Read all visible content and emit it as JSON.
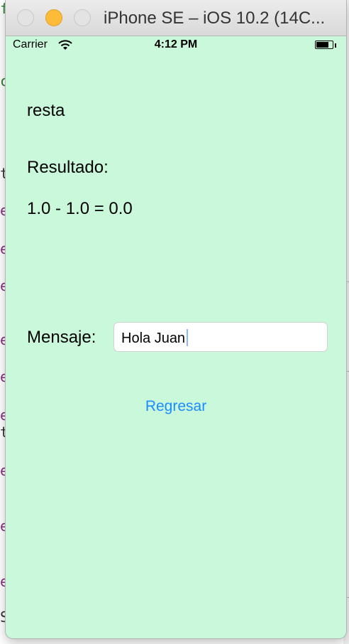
{
  "window": {
    "title": "iPhone SE – iOS 10.2 (14C..."
  },
  "statusbar": {
    "carrier": "Carrier",
    "time": "4:12 PM",
    "battery_level": 0.75
  },
  "screen": {
    "operation": "resta",
    "result_heading": "Resultado:",
    "result_value": "1.0 - 1.0 = 0.0",
    "message_label": "Mensaje:",
    "message_value": "Hola Juan",
    "back_button": "Regresar"
  },
  "colors": {
    "screen_background": "#c9f8da",
    "link_blue": "#1a8cff",
    "minimize_yellow": "#fcbc38"
  }
}
